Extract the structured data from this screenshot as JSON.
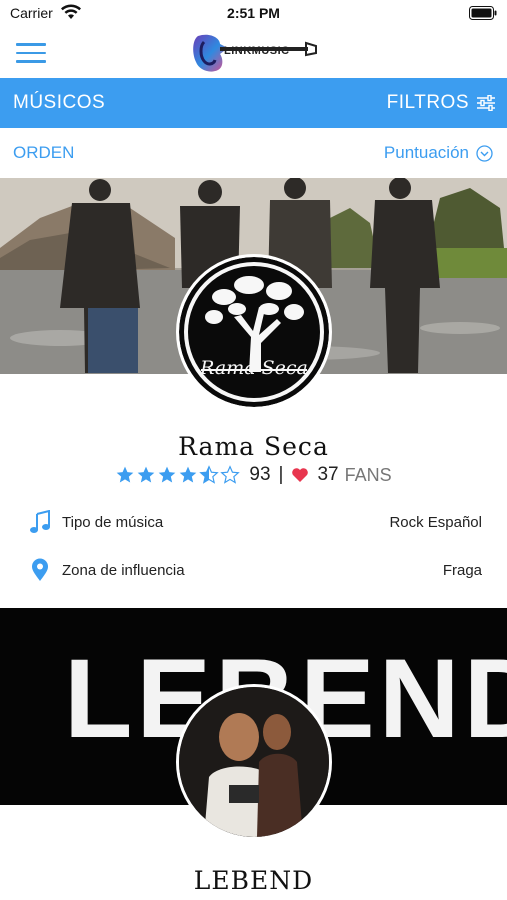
{
  "status_bar": {
    "carrier": "Carrier",
    "time": "2:51 PM"
  },
  "header": {
    "logo_text": "LINKMUSIC"
  },
  "nav": {
    "title": "MÚSICOS",
    "filter_label": "FILTROS"
  },
  "order": {
    "label": "ORDEN",
    "selected": "Puntuación"
  },
  "cards": [
    {
      "name": "Rama Seca",
      "logo_text": "Rama Seca",
      "rating": 4.5,
      "rating_value": "93",
      "separator": "|",
      "fans_count": "37",
      "fans_label": "FANS",
      "music_type_label": "Tipo de música",
      "music_type_value": "Rock Español",
      "zone_label": "Zona de influencia",
      "zone_value": "Fraga"
    },
    {
      "name": "LEBEND",
      "banner_text": "LEBEND"
    }
  ],
  "colors": {
    "accent": "#3c9df0",
    "heart": "#e8364f",
    "star": "#3c9df0"
  }
}
